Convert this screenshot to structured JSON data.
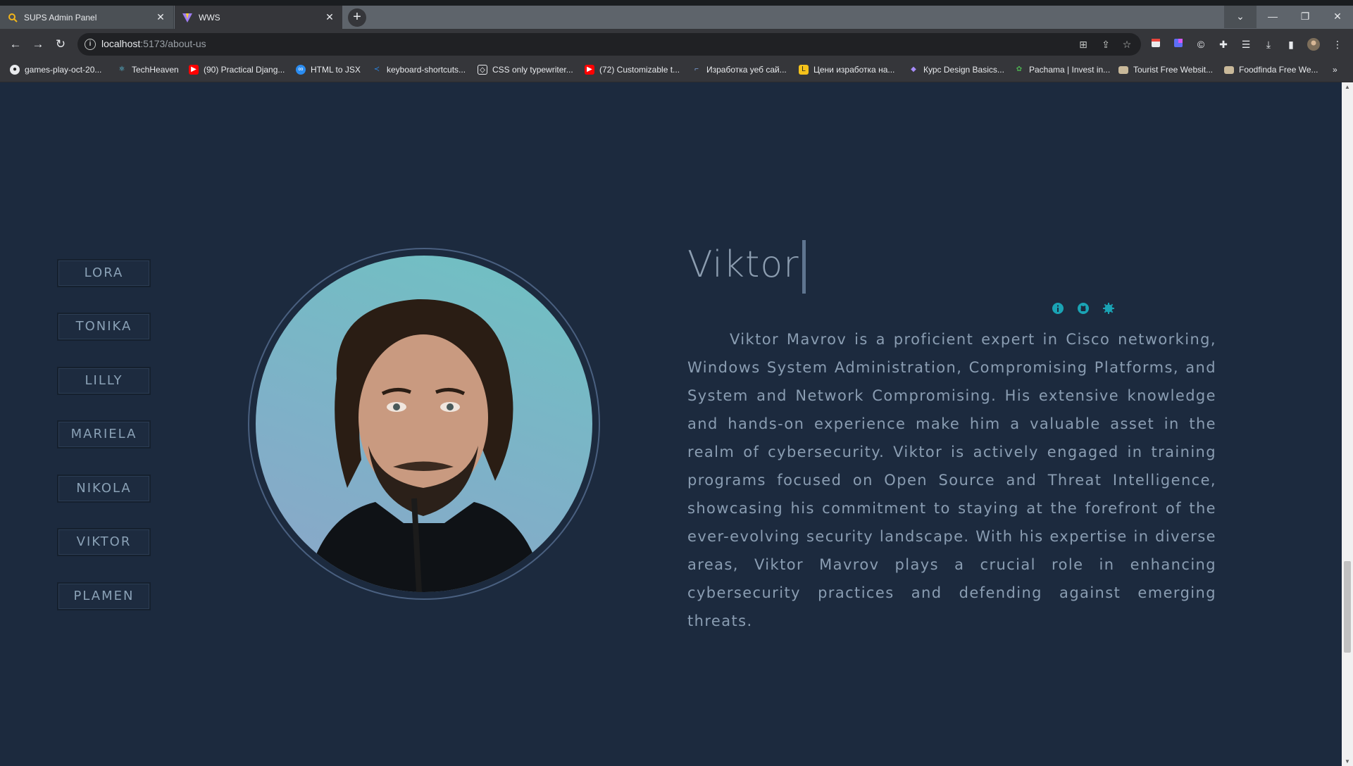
{
  "browser": {
    "tabs": [
      {
        "title": "SUPS Admin Panel",
        "active": false,
        "icon": "search-logo-icon"
      },
      {
        "title": "WWS",
        "active": true,
        "icon": "vite-logo-icon"
      }
    ],
    "address": {
      "host": "localhost",
      "path": ":5173/about-us"
    },
    "bookmarks": [
      {
        "label": "games-play-oct-20...",
        "icon": "github-icon"
      },
      {
        "label": "TechHeaven",
        "icon": "react-icon"
      },
      {
        "label": "(90) Practical Djang...",
        "icon": "youtube-icon"
      },
      {
        "label": "HTML to JSX",
        "icon": "transform-icon"
      },
      {
        "label": "keyboard-shortcuts...",
        "icon": "vscode-icon"
      },
      {
        "label": "CSS only typewriter...",
        "icon": "codepen-icon"
      },
      {
        "label": "(72) Customizable t...",
        "icon": "youtube-icon"
      },
      {
        "label": "Изработка уеб сай...",
        "icon": "site-icon"
      },
      {
        "label": "Цени изработка на...",
        "icon": "site-icon"
      },
      {
        "label": "Курс Design Basics...",
        "icon": "course-icon"
      },
      {
        "label": "Pachama | Invest in...",
        "icon": "pachama-icon"
      },
      {
        "label": "Tourist Free Websit...",
        "icon": "folder-icon"
      },
      {
        "label": "Foodfinda Free We...",
        "icon": "folder-icon"
      }
    ],
    "more_bookmarks": "»"
  },
  "team": {
    "members": [
      "LORA",
      "TONIKA",
      "LILLY",
      "MARIELA",
      "NIKOLA",
      "VIKTOR",
      "PLAMEN"
    ],
    "selected": "VIKTOR"
  },
  "profile": {
    "name": "Viktor",
    "bio": "Viktor Mavrov is a proficient expert in Cisco networking, Windows System Administration, Compromising Platforms, and System and Network Compromising. His extensive knowledge and hands-on experience make him a valuable asset in the realm of cybersecurity. Viktor is actively engaged in training programs focused on Open Source and Threat Intelligence, showcasing his commitment to staying at the forefront of the ever-evolving security landscape. With his expertise in diverse areas, Viktor Mavrov plays a crucial role in enhancing cybersecurity practices and defending against emerging threats.",
    "social_icons": [
      "info-icon",
      "github-icon",
      "settings-icon"
    ],
    "accent": "#1aa3b4"
  },
  "colors": {
    "page_bg": "#1c2a3e",
    "text": "#8a9db2"
  }
}
